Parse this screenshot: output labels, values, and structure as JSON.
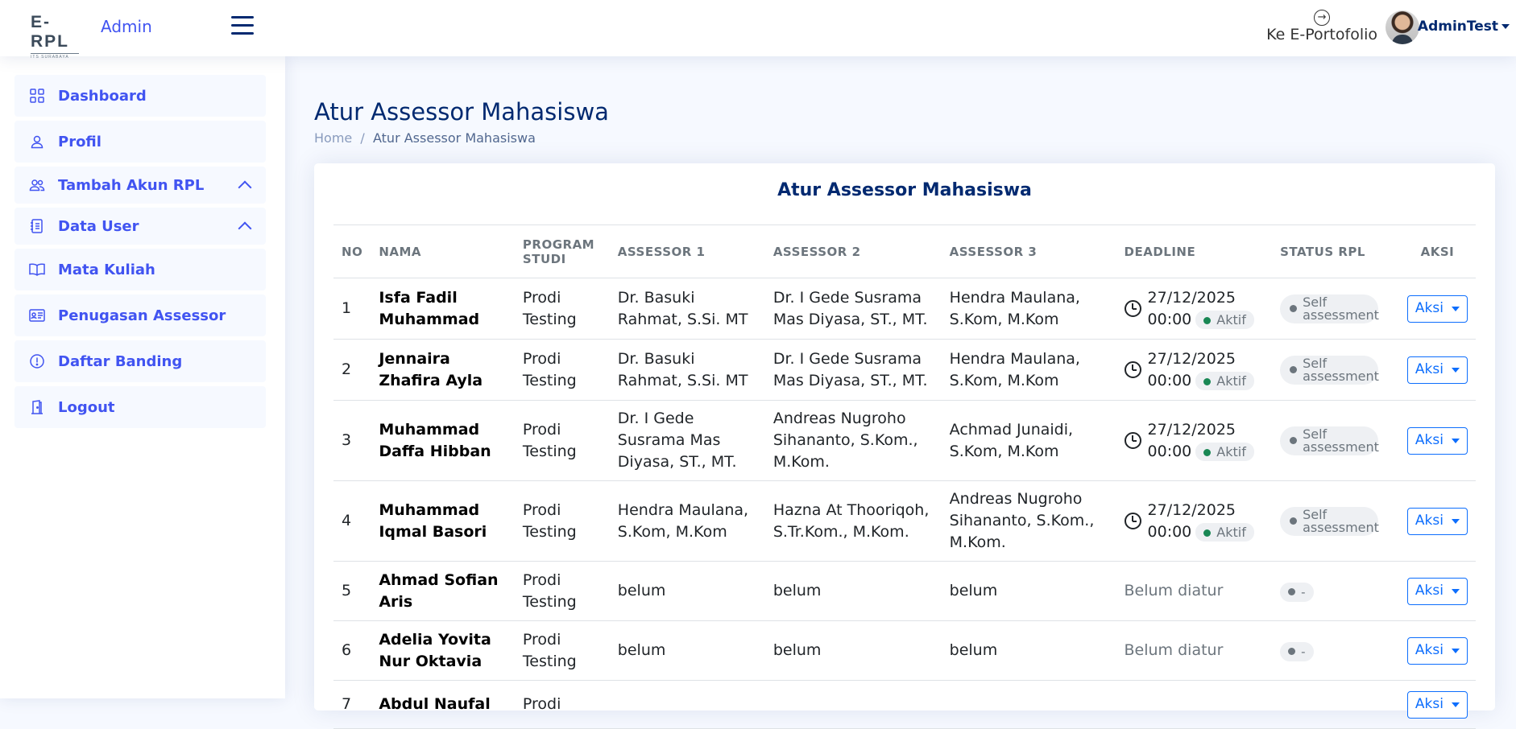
{
  "header": {
    "logo_text": "E-RPL",
    "logo_sub": "ITS SURABAYA",
    "brand": "Admin",
    "eportfolio_label": "Ke E-Portofolio",
    "user_name": "AdminTest"
  },
  "sidebar": {
    "items": [
      {
        "label": "Dashboard",
        "icon": "grid-icon"
      },
      {
        "label": "Profil",
        "icon": "person-icon"
      },
      {
        "label": "Tambah Akun RPL",
        "icon": "people-icon"
      },
      {
        "label": "Data User",
        "icon": "journal-icon"
      },
      {
        "label": "Mata Kuliah",
        "icon": "book-icon"
      },
      {
        "label": "Penugasan Assessor",
        "icon": "card-icon"
      },
      {
        "label": "Daftar Banding",
        "icon": "alert-icon"
      },
      {
        "label": "Logout",
        "icon": "door-icon"
      }
    ]
  },
  "page": {
    "title": "Atur Assessor Mahasiswa",
    "breadcrumb_home": "Home",
    "breadcrumb_sep": "/",
    "breadcrumb_current": "Atur Assessor Mahasiswa"
  },
  "card": {
    "title": "Atur Assessor Mahasiswa"
  },
  "table": {
    "headers": [
      "NO",
      "NAMA",
      "PROGRAM STUDI",
      "ASSESSOR 1",
      "ASSESSOR 2",
      "ASSESSOR 3",
      "DEADLINE",
      "STATUS RPL",
      "AKSI"
    ],
    "rows": [
      {
        "no": "1",
        "nama": "Isfa Fadil Muhammad",
        "prodi": "Prodi Testing",
        "a1": "Dr. Basuki Rahmat, S.Si. MT",
        "a2": "Dr. I Gede Susrama Mas Diyasa, ST., MT.",
        "a3": "Hendra Maulana, S.Kom, M.Kom",
        "date": "27/12/2025",
        "time": "00:00",
        "deadline_status": "Aktif",
        "status": "Self assessment",
        "aksi": "Aksi"
      },
      {
        "no": "2",
        "nama": "Jennaira Zhafira Ayla",
        "prodi": "Prodi Testing",
        "a1": "Dr. Basuki Rahmat, S.Si. MT",
        "a2": "Dr. I Gede Susrama Mas Diyasa, ST., MT.",
        "a3": "Hendra Maulana, S.Kom, M.Kom",
        "date": "27/12/2025",
        "time": "00:00",
        "deadline_status": "Aktif",
        "status": "Self assessment",
        "aksi": "Aksi"
      },
      {
        "no": "3",
        "nama": "Muhammad Daffa Hibban",
        "prodi": "Prodi Testing",
        "a1": "Dr. I Gede Susrama Mas Diyasa, ST., MT.",
        "a2": "Andreas Nugroho Sihananto, S.Kom., M.Kom.",
        "a3": "Achmad Junaidi, S.Kom, M.Kom",
        "date": "27/12/2025",
        "time": "00:00",
        "deadline_status": "Aktif",
        "status": "Self assessment",
        "aksi": "Aksi"
      },
      {
        "no": "4",
        "nama": "Muhammad Iqmal Basori",
        "prodi": "Prodi Testing",
        "a1": "Hendra Maulana, S.Kom, M.Kom",
        "a2": "Hazna At Thooriqoh, S.Tr.Kom., M.Kom.",
        "a3": "Andreas Nugroho Sihananto, S.Kom., M.Kom.",
        "date": "27/12/2025",
        "time": "00:00",
        "deadline_status": "Aktif",
        "status": "Self assessment",
        "aksi": "Aksi"
      },
      {
        "no": "5",
        "nama": "Ahmad Sofian Aris",
        "prodi": "Prodi Testing",
        "a1": "belum",
        "a2": "belum",
        "a3": "belum",
        "deadline_text": "Belum diatur",
        "status": "-",
        "aksi": "Aksi"
      },
      {
        "no": "6",
        "nama": "Adelia Yovita Nur Oktavia",
        "prodi": "Prodi Testing",
        "a1": "belum",
        "a2": "belum",
        "a3": "belum",
        "deadline_text": "Belum diatur",
        "status": "-",
        "aksi": "Aksi"
      },
      {
        "no": "7",
        "nama": "Abdul Naufal",
        "prodi": "Prodi",
        "a1": "",
        "a2": "",
        "a3": "",
        "deadline_text": "",
        "status": "",
        "aksi": "Aksi"
      }
    ]
  },
  "colors": {
    "primary": "#4154f1",
    "navy": "#012970",
    "button_blue": "#0d6efd",
    "active_green": "#198754"
  }
}
